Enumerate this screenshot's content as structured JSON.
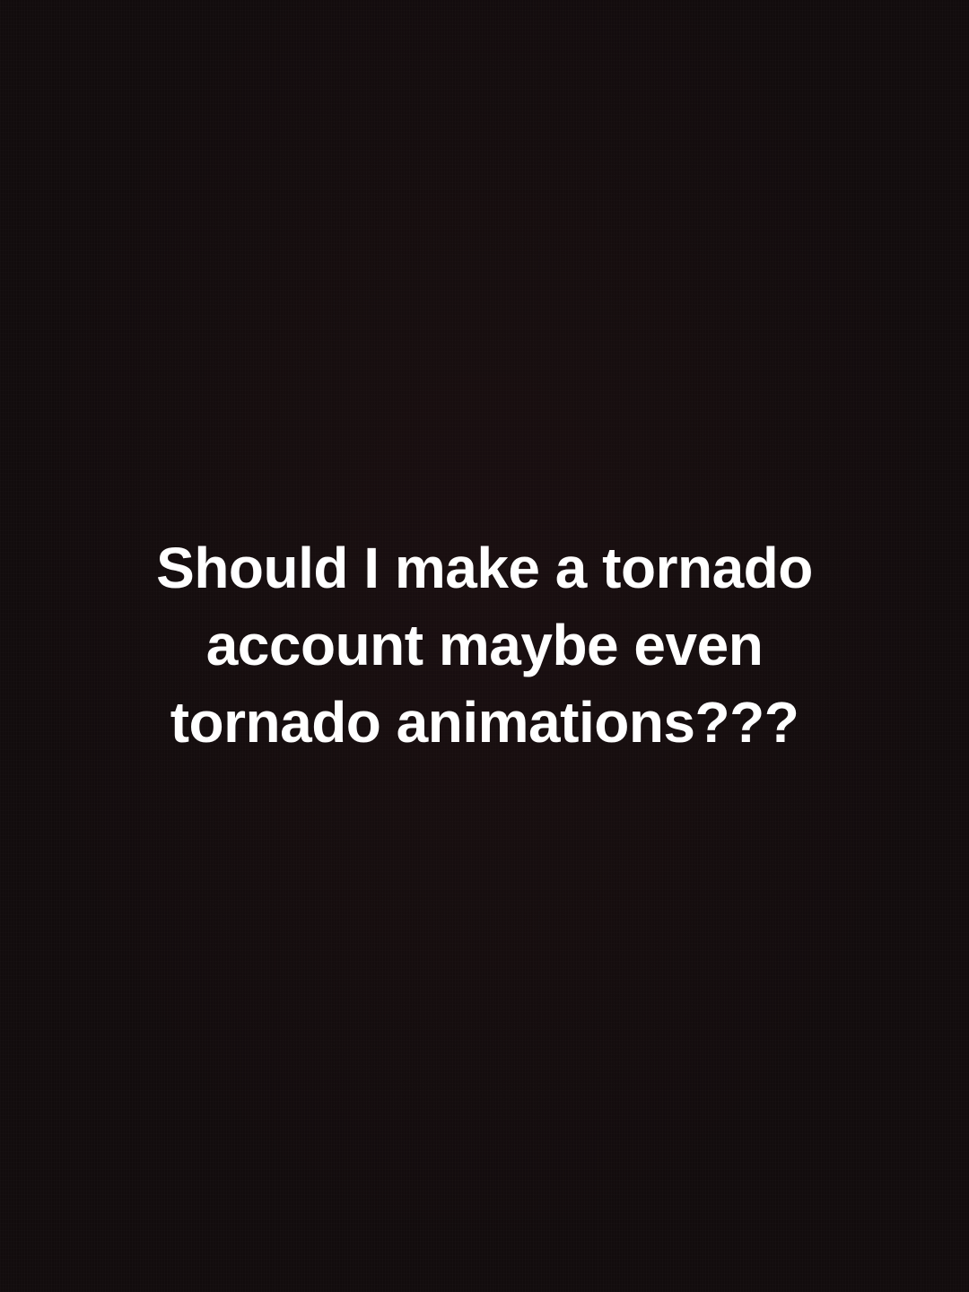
{
  "caption": {
    "lines": [
      "Should I make a tornado",
      "account maybe even",
      "tornado animations???"
    ]
  },
  "colors": {
    "background": "#120c0d",
    "text": "#ffffff"
  }
}
